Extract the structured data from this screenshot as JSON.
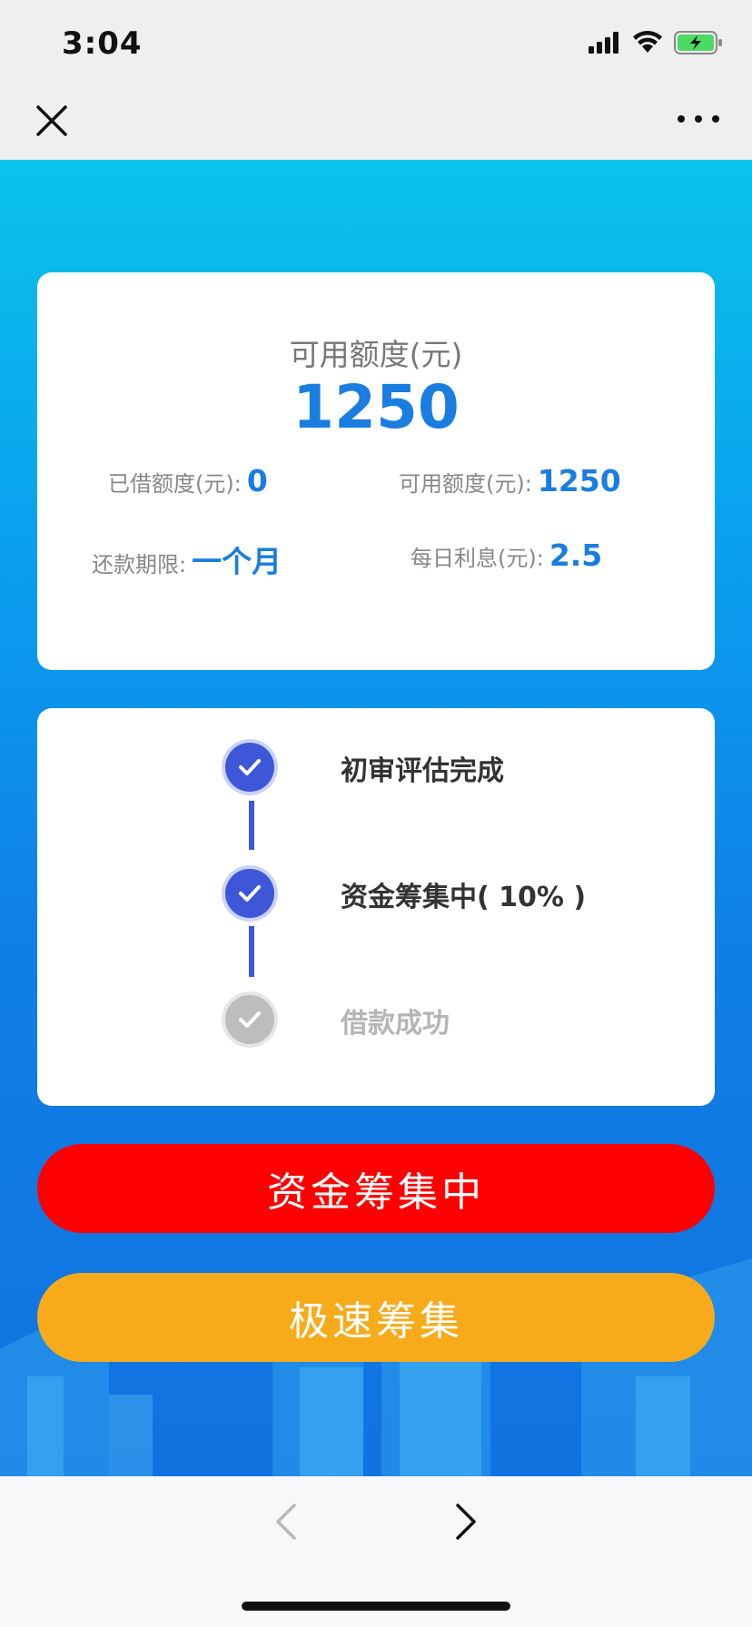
{
  "status_bar": {
    "time": "3:04"
  },
  "nav": {
    "close_icon": "close-icon",
    "more_icon": "more-icon"
  },
  "quota": {
    "label": "可用额度(元)",
    "amount": "1250",
    "borrowed_label": "已借额度(元):",
    "borrowed_value": "0",
    "available_label": "可用额度(元):",
    "available_value": "1250",
    "term_label": "还款期限:",
    "term_value": "一个月",
    "interest_label": "每日利息(元):",
    "interest_value": "2.5"
  },
  "progress": {
    "steps": [
      {
        "label": "初审评估完成",
        "status": "done"
      },
      {
        "label": "资金筹集中( 10% )",
        "status": "done"
      },
      {
        "label": "借款成功",
        "status": "pending"
      }
    ]
  },
  "buttons": {
    "raise_label": "资金筹集中",
    "fast_label": "极速筹集"
  },
  "colors": {
    "accent_blue": "#1a7de0",
    "step_done": "#3e57d9",
    "step_pending": "#bdbdbd",
    "btn_red": "#ff0000",
    "btn_orange": "#f7ab1b"
  }
}
